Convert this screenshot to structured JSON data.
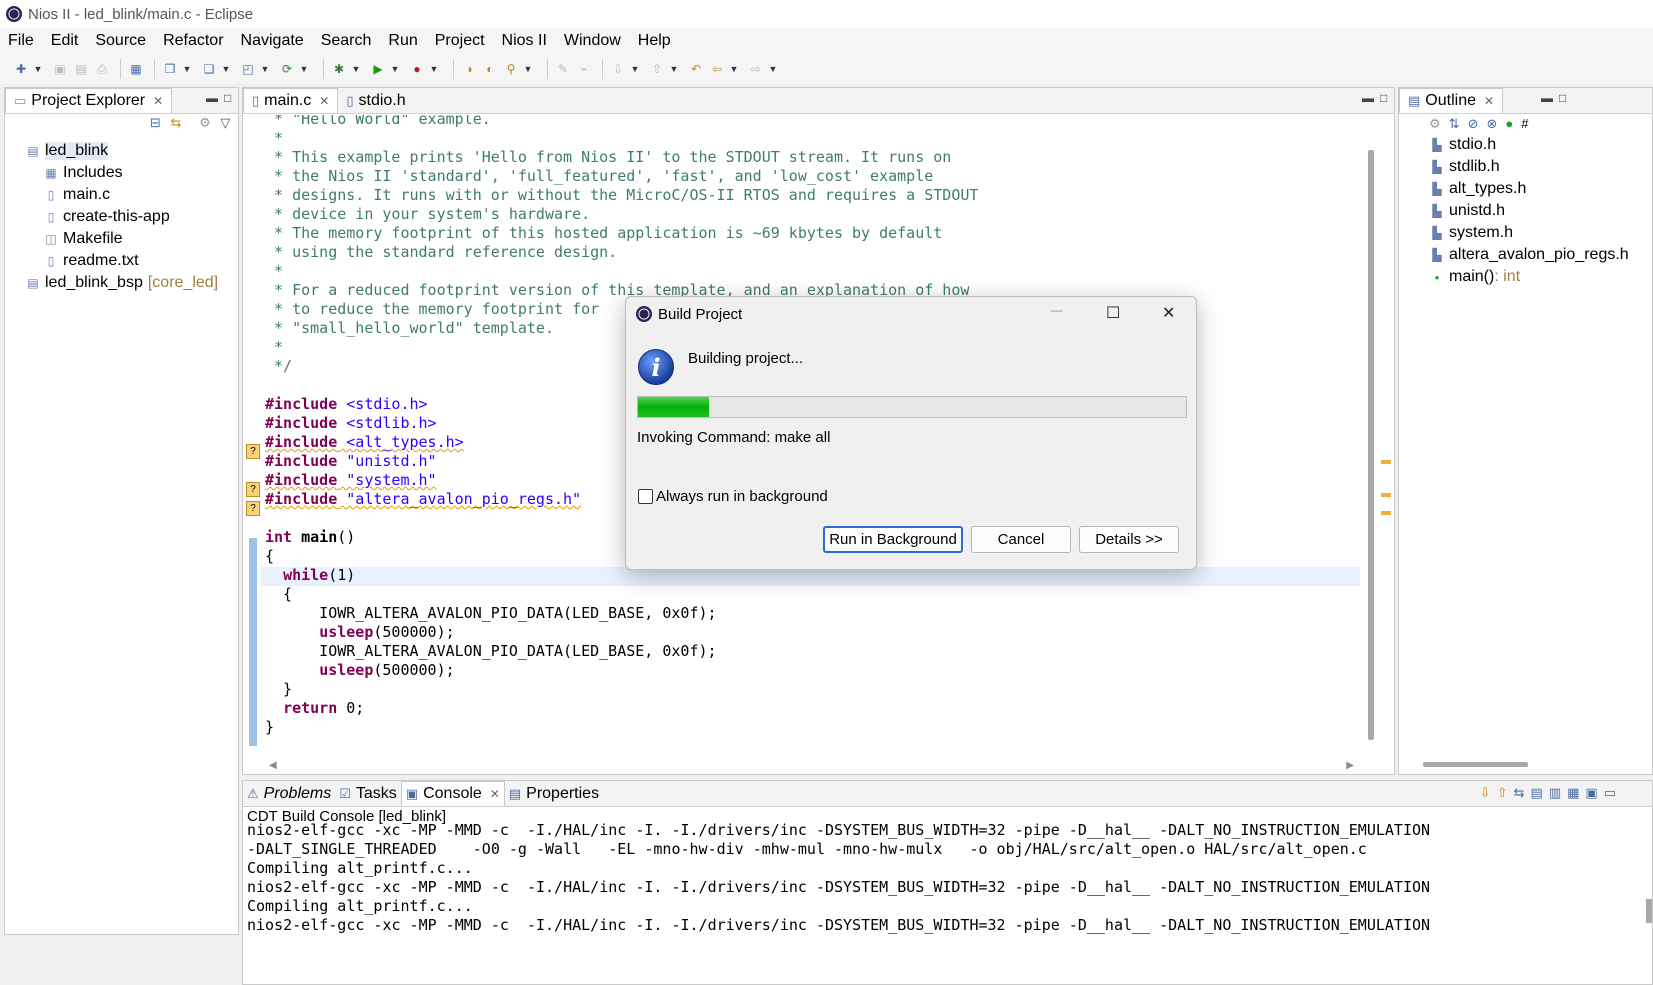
{
  "window": {
    "title": "Nios II - led_blink/main.c - Eclipse"
  },
  "menu": [
    "File",
    "Edit",
    "Source",
    "Refactor",
    "Navigate",
    "Search",
    "Run",
    "Project",
    "Nios II",
    "Window",
    "Help"
  ],
  "project_explorer": {
    "tab_label": "Project Explorer",
    "items": [
      {
        "label": "led_blink",
        "icon": "project-icon",
        "level": 0
      },
      {
        "label": "Includes",
        "icon": "includes-icon",
        "level": 1
      },
      {
        "label": "main.c",
        "icon": "c-file-icon",
        "level": 1
      },
      {
        "label": "create-this-app",
        "icon": "file-icon",
        "level": 1
      },
      {
        "label": "Makefile",
        "icon": "makefile-icon",
        "level": 1
      },
      {
        "label": "readme.txt",
        "icon": "text-file-icon",
        "level": 1
      },
      {
        "label": "led_blink_bsp",
        "icon": "project-icon",
        "level": 0,
        "decoration": "[core_led]"
      }
    ]
  },
  "editor": {
    "tabs": [
      {
        "label": "main.c",
        "active": true
      },
      {
        "label": "stdio.h",
        "active": false
      }
    ],
    "lines": [
      [
        {
          "t": " * \"Hello World\" example.",
          "c": "cmt"
        }
      ],
      [
        {
          "t": " *",
          "c": "cmt"
        }
      ],
      [
        {
          "t": " * This example prints 'Hello from Nios II' to the STDOUT stream. It runs on",
          "c": "cmt"
        }
      ],
      [
        {
          "t": " * the Nios II 'standard', 'full_featured', 'fast', and 'low_cost' example",
          "c": "cmt"
        }
      ],
      [
        {
          "t": " * designs. It runs with or without the MicroC/OS-II RTOS and requires a STDOUT",
          "c": "cmt"
        }
      ],
      [
        {
          "t": " * device in your system's hardware.",
          "c": "cmt"
        }
      ],
      [
        {
          "t": " * The memory footprint of this hosted application is ~69 kbytes by default",
          "c": "cmt"
        }
      ],
      [
        {
          "t": " * using the standard reference design.",
          "c": "cmt"
        }
      ],
      [
        {
          "t": " *",
          "c": "cmt"
        }
      ],
      [
        {
          "t": " * For a reduced footprint version of this template, and an explanation of how",
          "c": "cmt"
        }
      ],
      [
        {
          "t": " * to reduce the memory footprint for",
          "c": "cmt"
        }
      ],
      [
        {
          "t": " * \"small_hello_world\" template.",
          "c": "cmt"
        }
      ],
      [
        {
          "t": " *",
          "c": "cmt"
        }
      ],
      [
        {
          "t": " */",
          "c": "cmt"
        }
      ],
      [
        {
          "t": "",
          "c": ""
        }
      ],
      [
        {
          "t": "#include",
          "c": "kw"
        },
        {
          "t": " <stdio.h>",
          "c": "inc"
        }
      ],
      [
        {
          "t": "#include",
          "c": "kw"
        },
        {
          "t": " <stdlib.h>",
          "c": "inc"
        }
      ],
      [
        {
          "t": "#include",
          "c": "kw squig"
        },
        {
          "t": " <alt_types.h>",
          "c": "inc squig"
        }
      ],
      [
        {
          "t": "#include",
          "c": "kw"
        },
        {
          "t": " \"unistd.h\"",
          "c": "inc"
        }
      ],
      [
        {
          "t": "#include",
          "c": "kw squig"
        },
        {
          "t": " \"system.h\"",
          "c": "inc squig"
        }
      ],
      [
        {
          "t": "#include",
          "c": "kw squig"
        },
        {
          "t": " \"altera_avalon_pio_regs.h\"",
          "c": "inc squig"
        }
      ],
      [
        {
          "t": "",
          "c": ""
        }
      ],
      [
        {
          "t": "int",
          "c": "kw"
        },
        {
          "t": " ",
          "c": ""
        },
        {
          "t": "main",
          "c": "fn"
        },
        {
          "t": "()",
          "c": ""
        }
      ],
      [
        {
          "t": "{",
          "c": ""
        }
      ],
      [
        {
          "t": "  ",
          "c": ""
        },
        {
          "t": "while",
          "c": "kw"
        },
        {
          "t": "(1)",
          "c": ""
        }
      ],
      [
        {
          "t": "  {",
          "c": ""
        }
      ],
      [
        {
          "t": "      IOWR_ALTERA_AVALON_PIO_DATA(LED_BASE, 0x0f);",
          "c": ""
        }
      ],
      [
        {
          "t": "      ",
          "c": ""
        },
        {
          "t": "usleep",
          "c": "kw"
        },
        {
          "t": "(500000);",
          "c": ""
        }
      ],
      [
        {
          "t": "      IOWR_ALTERA_AVALON_PIO_DATA(LED_BASE, 0x0f);",
          "c": ""
        }
      ],
      [
        {
          "t": "      ",
          "c": ""
        },
        {
          "t": "usleep",
          "c": "kw"
        },
        {
          "t": "(500000);",
          "c": ""
        }
      ],
      [
        {
          "t": "  }",
          "c": ""
        }
      ],
      [
        {
          "t": "  ",
          "c": ""
        },
        {
          "t": "return",
          "c": "kw"
        },
        {
          "t": " 0;",
          "c": ""
        }
      ],
      [
        {
          "t": "}",
          "c": ""
        }
      ]
    ]
  },
  "outline": {
    "tab_label": "Outline",
    "items": [
      {
        "label": "stdio.h"
      },
      {
        "label": "stdlib.h"
      },
      {
        "label": "alt_types.h"
      },
      {
        "label": "unistd.h"
      },
      {
        "label": "system.h"
      },
      {
        "label": "altera_avalon_pio_regs.h"
      },
      {
        "label": "main()",
        "type": " : int"
      }
    ]
  },
  "bottom": {
    "tabs": [
      {
        "label": "Problems",
        "active": false
      },
      {
        "label": "Tasks",
        "active": false
      },
      {
        "label": "Console",
        "active": true
      },
      {
        "label": "Properties",
        "active": false
      }
    ],
    "console_title": "CDT Build Console [led_blink]",
    "console_lines": [
      "nios2-elf-gcc -xc -MP -MMD -c  -I./HAL/inc -I. -I./drivers/inc -DSYSTEM_BUS_WIDTH=32 -pipe -D__hal__ -DALT_NO_INSTRUCTION_EMULATION",
      "-DALT_SINGLE_THREADED    -O0 -g -Wall   -EL -mno-hw-div -mhw-mul -mno-hw-mulx   -o obj/HAL/src/alt_open.o HAL/src/alt_open.c",
      "Compiling alt_printf.c...",
      "nios2-elf-gcc -xc -MP -MMD -c  -I./HAL/inc -I. -I./drivers/inc -DSYSTEM_BUS_WIDTH=32 -pipe -D__hal__ -DALT_NO_INSTRUCTION_EMULATION",
      "Compiling alt_printf.c...",
      "nios2-elf-gcc -xc -MP -MMD -c  -I./HAL/inc -I. -I./drivers/inc -DSYSTEM_BUS_WIDTH=32 -pipe -D__hal__ -DALT_NO_INSTRUCTION_EMULATION"
    ]
  },
  "dialog": {
    "title": "Build Project",
    "message": "Building project...",
    "progress": 0.13,
    "status": "Invoking Command: make all",
    "checkbox_label": "Always run in background",
    "checkbox_checked": false,
    "buttons": {
      "run_background": "Run in Background",
      "cancel": "Cancel",
      "details": "Details >>"
    }
  },
  "colors": {
    "accent": "#2a6bd5",
    "progress": "#06b006"
  }
}
